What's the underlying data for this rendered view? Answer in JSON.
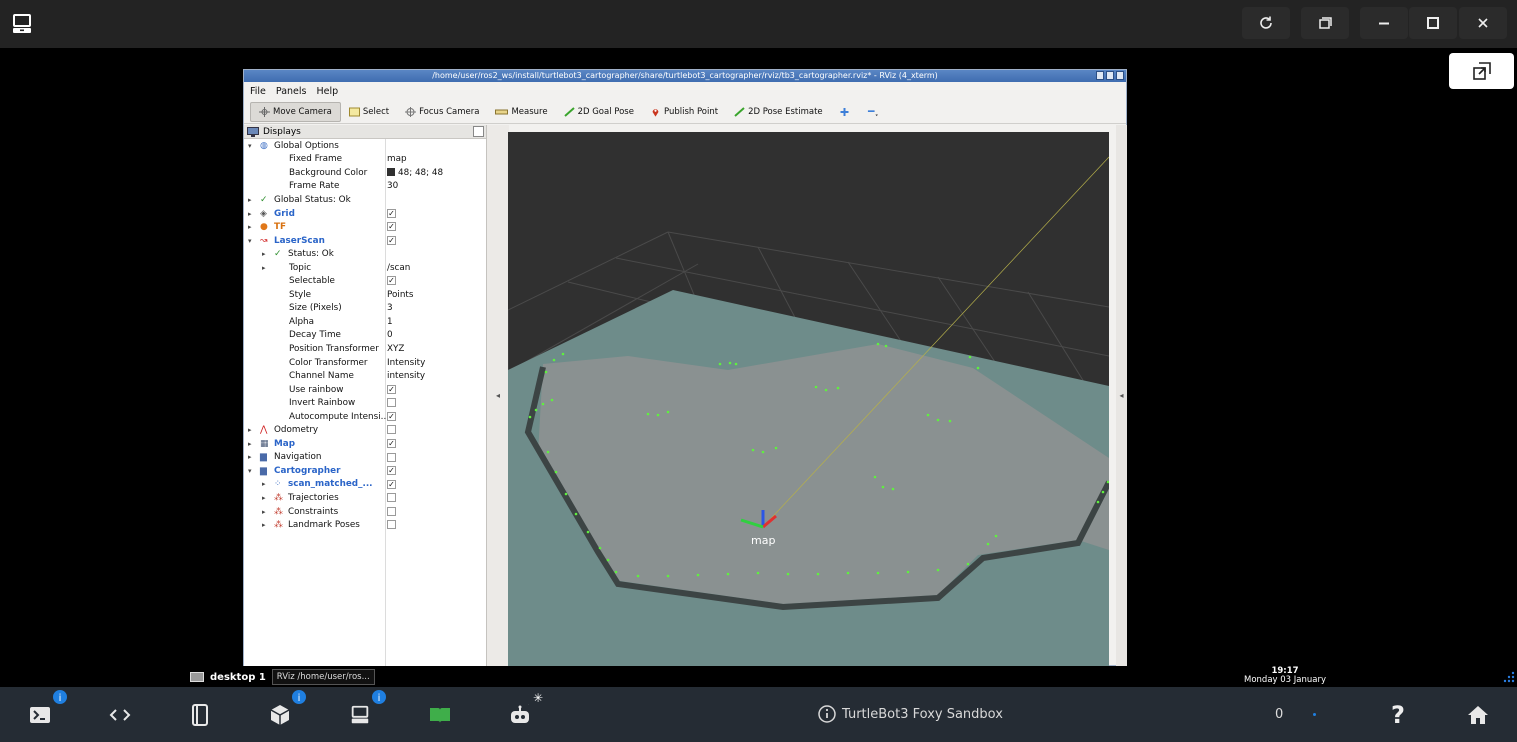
{
  "window": {
    "title": "/home/user/ros2_ws/install/turtlebot3_cartographer/share/turtlebot3_cartographer/rviz/tb3_cartographer.rviz* - RViz (4_xterm)"
  },
  "menu": [
    "File",
    "Panels",
    "Help"
  ],
  "toolbar": {
    "tools": [
      "Move Camera",
      "Select",
      "Focus Camera",
      "Measure",
      "2D Goal Pose",
      "Publish Point",
      "2D Pose Estimate"
    ],
    "add_icon": "plus-icon",
    "remove_icon": "minus-icon"
  },
  "displays": {
    "header": "Displays",
    "rows": [
      {
        "label": "Global Options",
        "value": "",
        "indent": 0,
        "expanded": true,
        "icon": "globe-icon"
      },
      {
        "label": "Fixed Frame",
        "value": "map",
        "indent": 1
      },
      {
        "label": "Background Color",
        "value": "48; 48; 48",
        "indent": 1,
        "swatch": "#303030"
      },
      {
        "label": "Frame Rate",
        "value": "30",
        "indent": 1
      },
      {
        "label": "Global Status: Ok",
        "value": "",
        "indent": 0,
        "collapsed": true,
        "icon": "check-icon"
      },
      {
        "label": "Grid",
        "checked": true,
        "indent": 0,
        "collapsed": true,
        "icon": "grid-icon",
        "style": "blue"
      },
      {
        "label": "TF",
        "checked": true,
        "indent": 0,
        "collapsed": true,
        "icon": "tf-icon",
        "style": "orange"
      },
      {
        "label": "LaserScan",
        "checked": true,
        "indent": 0,
        "expanded": true,
        "icon": "laserscan-icon",
        "style": "blue"
      },
      {
        "label": "Status: Ok",
        "value": "",
        "indent": 1,
        "collapsed": true,
        "icon": "check-icon"
      },
      {
        "label": "Topic",
        "value": "/scan",
        "indent": 1,
        "collapsed": true
      },
      {
        "label": "Selectable",
        "checked": true,
        "indent": 1
      },
      {
        "label": "Style",
        "value": "Points",
        "indent": 1
      },
      {
        "label": "Size (Pixels)",
        "value": "3",
        "indent": 1
      },
      {
        "label": "Alpha",
        "value": "1",
        "indent": 1
      },
      {
        "label": "Decay Time",
        "value": "0",
        "indent": 1
      },
      {
        "label": "Position Transformer",
        "value": "XYZ",
        "indent": 1
      },
      {
        "label": "Color Transformer",
        "value": "Intensity",
        "indent": 1
      },
      {
        "label": "Channel Name",
        "value": "intensity",
        "indent": 1
      },
      {
        "label": "Use rainbow",
        "checked": true,
        "indent": 1
      },
      {
        "label": "Invert Rainbow",
        "checked": false,
        "indent": 1
      },
      {
        "label": "Autocompute Intensi...",
        "checked": true,
        "indent": 1
      },
      {
        "label": "Odometry",
        "checked": false,
        "indent": 0,
        "collapsed": true,
        "icon": "odometry-icon"
      },
      {
        "label": "Map",
        "checked": true,
        "indent": 0,
        "collapsed": true,
        "icon": "map-icon",
        "style": "blue"
      },
      {
        "label": "Navigation",
        "checked": false,
        "indent": 0,
        "collapsed": true,
        "icon": "folder-icon"
      },
      {
        "label": "Cartographer",
        "checked": true,
        "indent": 0,
        "expanded": true,
        "icon": "folder-icon",
        "style": "blue"
      },
      {
        "label": "scan_matched_...",
        "checked": true,
        "indent": 1,
        "collapsed": true,
        "icon": "pointcloud-icon",
        "style": "blue"
      },
      {
        "label": "Trajectories",
        "checked": false,
        "indent": 1,
        "collapsed": true,
        "icon": "markers-icon"
      },
      {
        "label": "Constraints",
        "checked": false,
        "indent": 1,
        "collapsed": true,
        "icon": "markers-icon"
      },
      {
        "label": "Landmark Poses",
        "checked": false,
        "indent": 1,
        "collapsed": true,
        "icon": "markers-icon"
      }
    ]
  },
  "viewport": {
    "frame_label": "map"
  },
  "taskbar": {
    "desktop_label": "desktop 1",
    "task_label": "/home/user/ros...",
    "time": "19:17",
    "date": "Monday 03 January"
  },
  "bottombar": {
    "title": "TurtleBot3 Foxy Sandbox",
    "count": "0",
    "badge_1": "i",
    "badge_2": "i",
    "badge_3": "i",
    "help_label": "?"
  }
}
